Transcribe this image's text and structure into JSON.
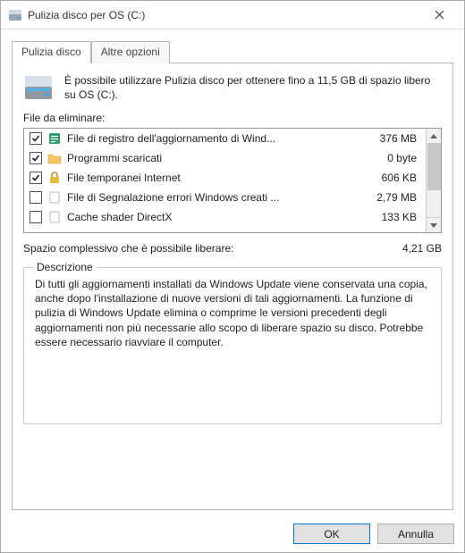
{
  "window": {
    "title": "Pulizia disco per OS (C:)"
  },
  "tabs": {
    "cleanup": "Pulizia disco",
    "more": "Altre opzioni"
  },
  "summary": "È possibile utilizzare Pulizia disco per ottenere fino a 11,5 GB di spazio libero su OS (C:).",
  "labels": {
    "filesToDelete": "File da eliminare:",
    "totalSpace": "Spazio complessivo che è possibile liberare:",
    "descriptionTitle": "Descrizione"
  },
  "files": [
    {
      "checked": true,
      "icon": "log",
      "name": "File di registro dell'aggiornamento di Wind...",
      "size": "376 MB"
    },
    {
      "checked": true,
      "icon": "folder",
      "name": "Programmi scaricati",
      "size": "0 byte"
    },
    {
      "checked": true,
      "icon": "lock",
      "name": "File temporanei Internet",
      "size": "606 KB"
    },
    {
      "checked": false,
      "icon": "blank",
      "name": "File di Segnalazione errori Windows creati ...",
      "size": "2,79 MB"
    },
    {
      "checked": false,
      "icon": "blank",
      "name": "Cache shader DirectX",
      "size": "133 KB"
    }
  ],
  "total": "4,21 GB",
  "description": "Di tutti gli aggiornamenti installati da Windows Update viene conservata una copia, anche dopo l'installazione di nuove versioni di tali aggiornamenti. La funzione di pulizia di Windows Update elimina o comprime le versioni precedenti degli aggiornamenti non più necessarie allo scopo di liberare spazio su disco. Potrebbe essere necessario riavviare il computer.",
  "buttons": {
    "ok": "OK",
    "cancel": "Annulla"
  }
}
